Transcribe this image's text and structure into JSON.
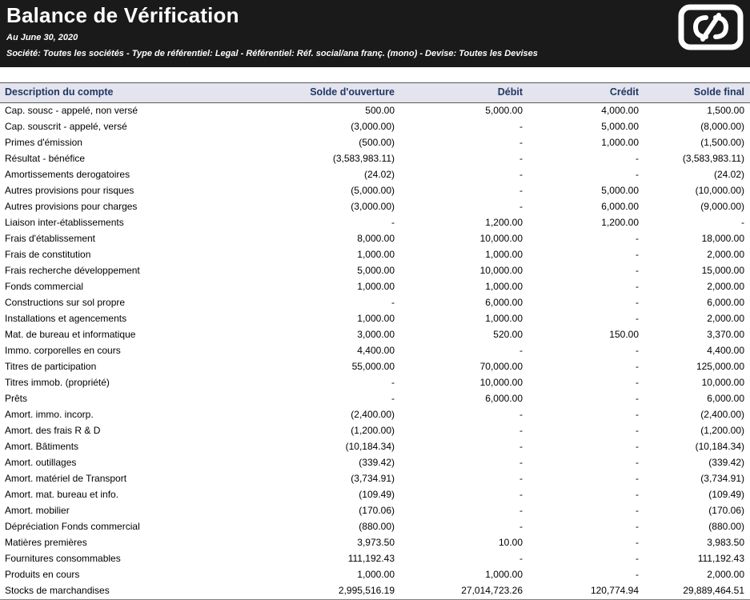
{
  "header": {
    "title": "Balance de Vérification",
    "date_line": "Au June 30, 2020",
    "filters_line": "Société: Toutes les sociétés  - Type de référentiel: Legal  - Référentiel: Réf. social/ana franç. (mono) - Devise: Toutes les Devises",
    "logo_icon": "brand-logo-icon",
    "colors": {
      "header_bg": "#1a1a1a",
      "header_text": "#ffffff",
      "table_header_bg": "#e4e4ee",
      "table_header_text": "#1f3864"
    }
  },
  "table": {
    "columns": [
      "Description du compte",
      "Solde d'ouverture",
      "Débit",
      "Crédit",
      "Solde final"
    ],
    "rows": [
      [
        "Cap. sousc - appelé, non versé",
        "500.00",
        "5,000.00",
        "4,000.00",
        "1,500.00"
      ],
      [
        "Cap. souscrit - appelé, versé",
        "(3,000.00)",
        "-",
        "5,000.00",
        "(8,000.00)"
      ],
      [
        "Primes d'émission",
        "(500.00)",
        "-",
        "1,000.00",
        "(1,500.00)"
      ],
      [
        "Résultat - bénéfice",
        "(3,583,983.11)",
        "-",
        "-",
        "(3,583,983.11)"
      ],
      [
        "Amortissements derogatoires",
        "(24.02)",
        "-",
        "-",
        "(24.02)"
      ],
      [
        "Autres provisions pour risques",
        "(5,000.00)",
        "-",
        "5,000.00",
        "(10,000.00)"
      ],
      [
        "Autres provisions pour charges",
        "(3,000.00)",
        "-",
        "6,000.00",
        "(9,000.00)"
      ],
      [
        "Liaison inter-établissements",
        "-",
        "1,200.00",
        "1,200.00",
        "-"
      ],
      [
        "Frais d'établissement",
        "8,000.00",
        "10,000.00",
        "-",
        "18,000.00"
      ],
      [
        "Frais de constitution",
        "1,000.00",
        "1,000.00",
        "-",
        "2,000.00"
      ],
      [
        "Frais recherche développement",
        "5,000.00",
        "10,000.00",
        "-",
        "15,000.00"
      ],
      [
        "Fonds commercial",
        "1,000.00",
        "1,000.00",
        "-",
        "2,000.00"
      ],
      [
        "Constructions sur sol propre",
        "-",
        "6,000.00",
        "-",
        "6,000.00"
      ],
      [
        "Installations et agencements",
        "1,000.00",
        "1,000.00",
        "-",
        "2,000.00"
      ],
      [
        "Mat. de bureau et informatique",
        "3,000.00",
        "520.00",
        "150.00",
        "3,370.00"
      ],
      [
        "Immo. corporelles en cours",
        "4,400.00",
        "-",
        "-",
        "4,400.00"
      ],
      [
        "Titres de participation",
        "55,000.00",
        "70,000.00",
        "-",
        "125,000.00"
      ],
      [
        "Titres immob. (propriété)",
        "-",
        "10,000.00",
        "-",
        "10,000.00"
      ],
      [
        "Prêts",
        "-",
        "6,000.00",
        "-",
        "6,000.00"
      ],
      [
        "Amort. immo. incorp.",
        "(2,400.00)",
        "-",
        "-",
        "(2,400.00)"
      ],
      [
        "Amort. des frais R & D",
        "(1,200.00)",
        "-",
        "-",
        "(1,200.00)"
      ],
      [
        "Amort. Bâtiments",
        "(10,184.34)",
        "-",
        "-",
        "(10,184.34)"
      ],
      [
        "Amort. outillages",
        "(339.42)",
        "-",
        "-",
        "(339.42)"
      ],
      [
        "Amort. matériel de Transport",
        "(3,734.91)",
        "-",
        "-",
        "(3,734.91)"
      ],
      [
        "Amort. mat. bureau et info.",
        "(109.49)",
        "-",
        "-",
        "(109.49)"
      ],
      [
        "Amort. mobilier",
        "(170.06)",
        "-",
        "-",
        "(170.06)"
      ],
      [
        "Dépréciation Fonds commercial",
        "(880.00)",
        "-",
        "-",
        "(880.00)"
      ],
      [
        "Matières premières",
        "3,973.50",
        "10.00",
        "-",
        "3,983.50"
      ],
      [
        "Fournitures consommables",
        "111,192.43",
        "-",
        "-",
        "111,192.43"
      ],
      [
        "Produits en cours",
        "1,000.00",
        "1,000.00",
        "-",
        "2,000.00"
      ],
      [
        "Stocks de marchandises",
        "2,995,516.19",
        "27,014,723.26",
        "120,774.94",
        "29,889,464.51"
      ]
    ]
  }
}
